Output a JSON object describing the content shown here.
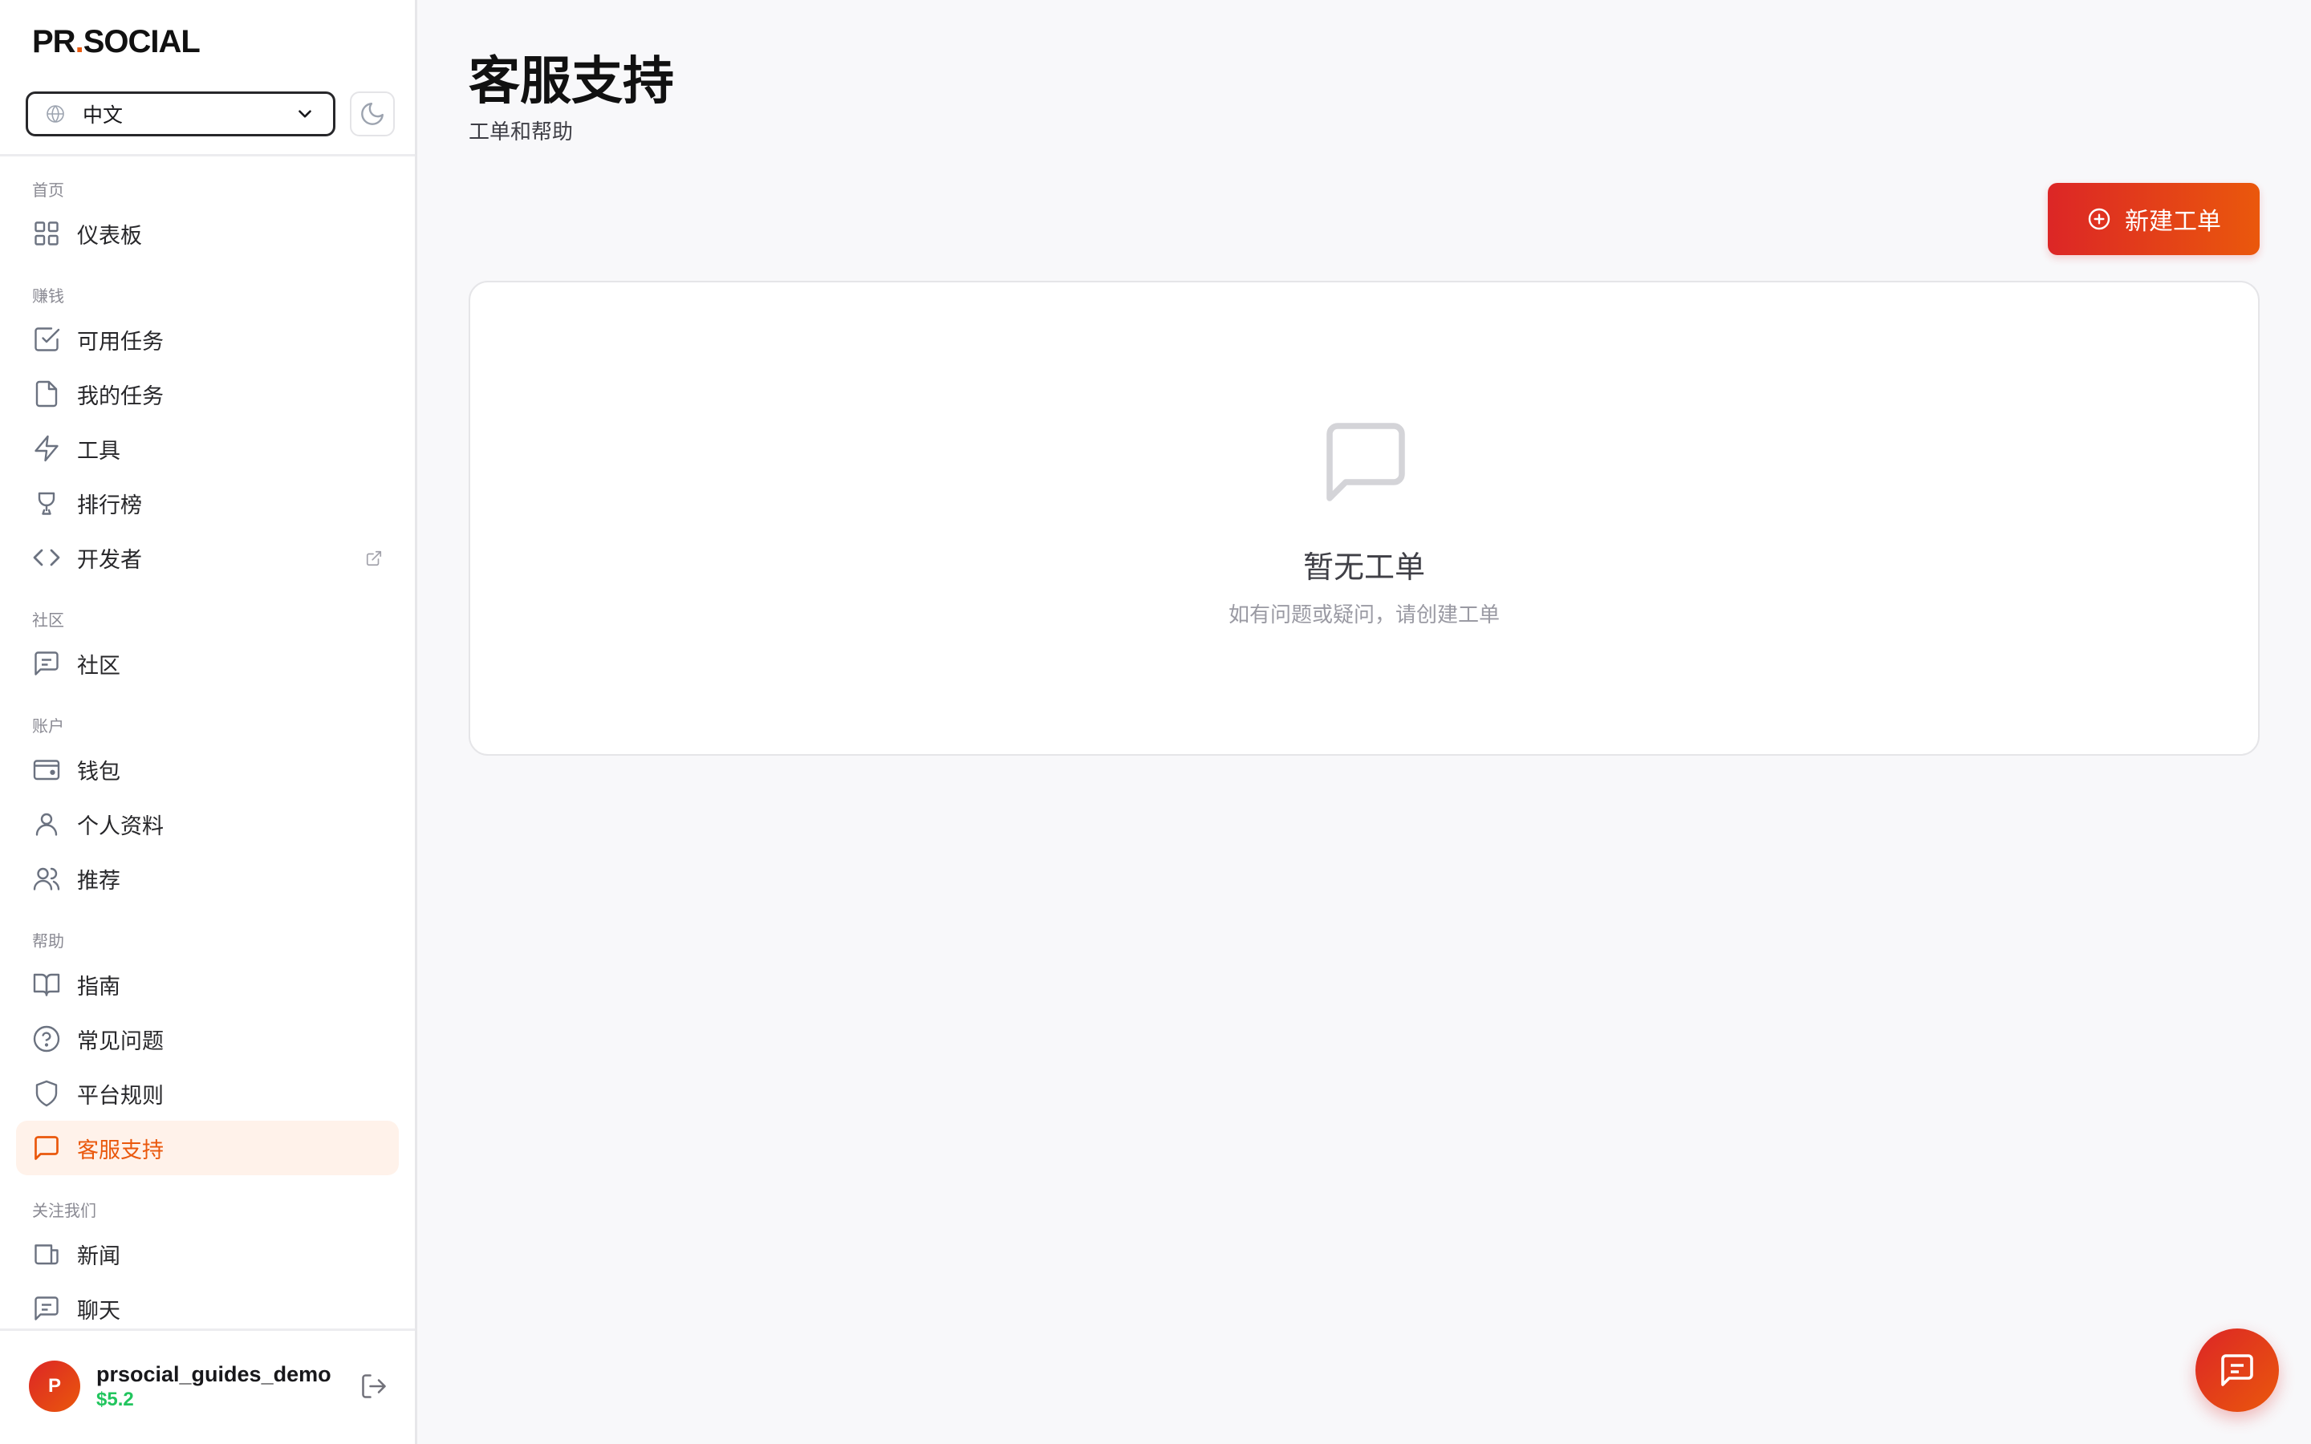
{
  "brand": {
    "logo_left": "PR",
    "logo_dot": ".",
    "logo_right": "SOCIAL"
  },
  "language": {
    "selected": "中文",
    "icon": "globe-icon"
  },
  "theme_toggle": {
    "icon": "moon-icon"
  },
  "nav": {
    "sections": [
      {
        "title": "首页",
        "items": [
          {
            "label": "仪表板",
            "icon": "dashboard-grid-icon"
          }
        ]
      },
      {
        "title": "赚钱",
        "items": [
          {
            "label": "可用任务",
            "icon": "check-square-icon"
          },
          {
            "label": "我的任务",
            "icon": "file-icon"
          },
          {
            "label": "工具",
            "icon": "lightning-icon"
          },
          {
            "label": "排行榜",
            "icon": "trophy-icon"
          },
          {
            "label": "开发者",
            "icon": "code-icon",
            "external": true
          }
        ]
      },
      {
        "title": "社区",
        "items": [
          {
            "label": "社区",
            "icon": "message-square-icon"
          }
        ]
      },
      {
        "title": "账户",
        "items": [
          {
            "label": "钱包",
            "icon": "wallet-icon"
          },
          {
            "label": "个人资料",
            "icon": "user-icon"
          },
          {
            "label": "推荐",
            "icon": "users-icon"
          }
        ]
      },
      {
        "title": "帮助",
        "items": [
          {
            "label": "指南",
            "icon": "book-icon"
          },
          {
            "label": "常见问题",
            "icon": "help-circle-icon"
          },
          {
            "label": "平台规则",
            "icon": "shield-icon"
          },
          {
            "label": "客服支持",
            "icon": "chat-bubble-icon",
            "active": true
          }
        ]
      },
      {
        "title": "关注我们",
        "items": [
          {
            "label": "新闻",
            "icon": "newspaper-icon"
          },
          {
            "label": "聊天",
            "icon": "message-square-icon"
          }
        ]
      }
    ]
  },
  "user": {
    "initial": "P",
    "name": "prsocial_guides_demo",
    "balance": "$5.2"
  },
  "page": {
    "title": "客服支持",
    "subtitle": "工单和帮助",
    "new_ticket_label": "新建工单",
    "empty_title": "暂无工单",
    "empty_desc": "如有问题或疑问，请创建工单"
  },
  "colors": {
    "accent": "#ea580c",
    "accent_red": "#dc2626",
    "active_bg": "#fff2ea",
    "balance_green": "#22c55e"
  }
}
